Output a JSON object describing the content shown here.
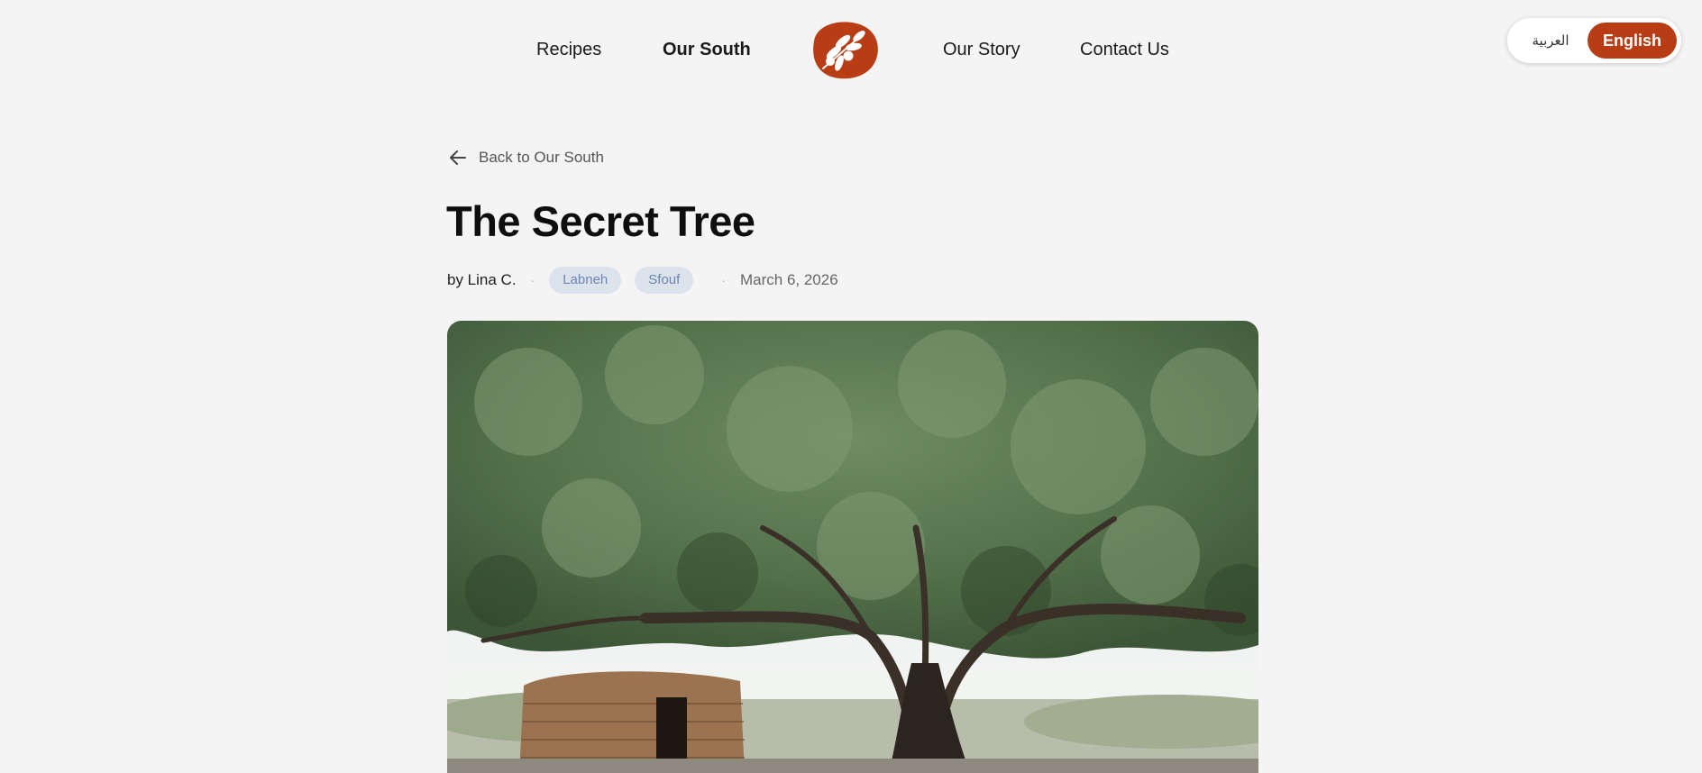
{
  "nav": {
    "links": [
      {
        "label": "Recipes",
        "active": false
      },
      {
        "label": "Our South",
        "active": true
      },
      {
        "label": "Our Story",
        "active": false
      },
      {
        "label": "Contact Us",
        "active": false
      }
    ],
    "logo_icon": "olive-branch-icon",
    "brand_color": "#b83d14"
  },
  "lang": {
    "arabic": "العربية",
    "english": "English",
    "selected": "English"
  },
  "article": {
    "back_label": "Back to Our South",
    "title": "The Secret Tree",
    "author": "by Lina C.",
    "tags": [
      "Labneh",
      "Sfouf"
    ],
    "date": "March 6, 2026",
    "hero_image": "oak-tree-with-stone-hut-photo"
  },
  "colors": {
    "background": "#f4f4f4",
    "tag_bg": "#dde3ec",
    "tag_text": "#6b86b4"
  }
}
